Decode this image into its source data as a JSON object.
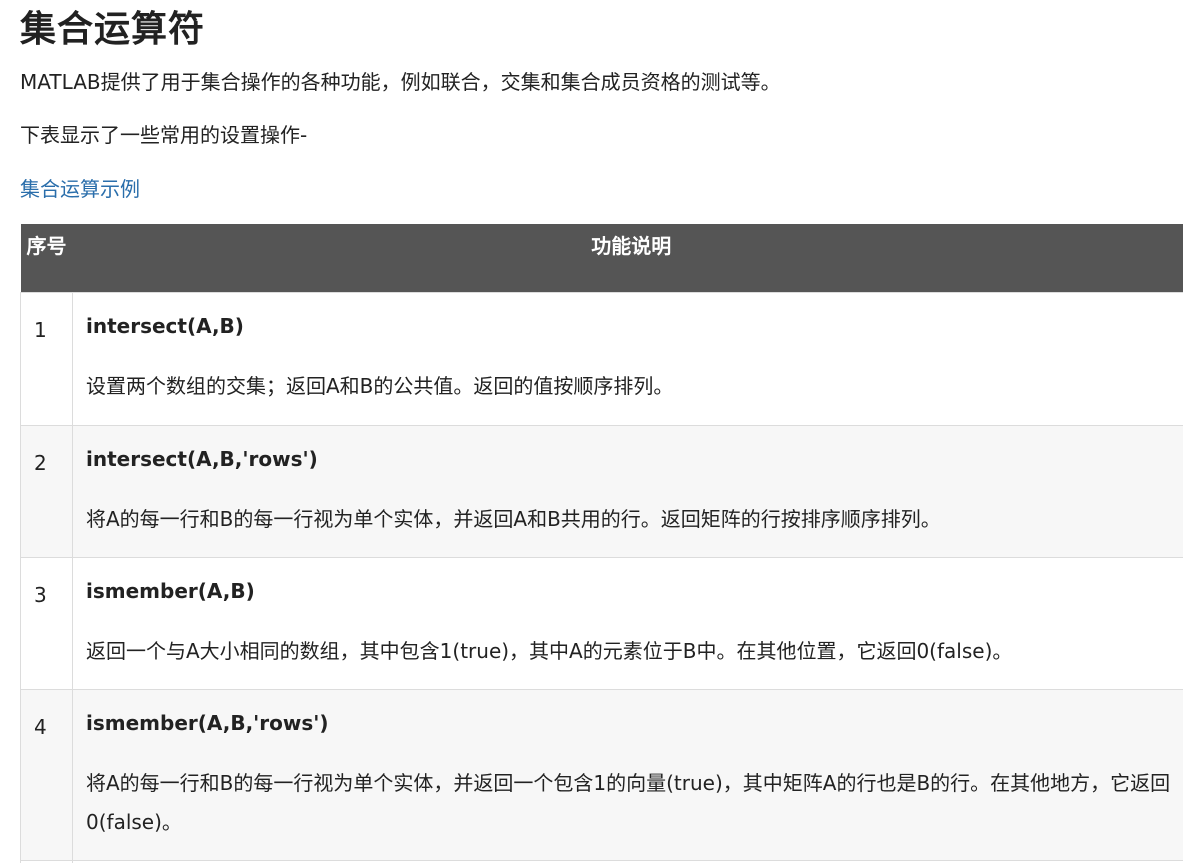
{
  "title": "集合运算符",
  "intro": "MATLAB提供了用于集合操作的各种功能，例如联合，交集和集合成员资格的测试等。",
  "subintro": "下表显示了一些常用的设置操作-",
  "example_link": "集合运算示例",
  "table": {
    "headers": [
      "序号",
      "功能说明"
    ],
    "rows": [
      {
        "num": "1",
        "func": "intersect(A,B)",
        "desc": "设置两个数组的交集；返回A和B的公共值。返回的值按顺序排列。"
      },
      {
        "num": "2",
        "func": "intersect(A,B,'rows')",
        "desc": "将A的每一行和B的每一行视为单个实体，并返回A和B共用的行。返回矩阵的行按排序顺序排列。"
      },
      {
        "num": "3",
        "func": "ismember(A,B)",
        "desc": "返回一个与A大小相同的数组，其中包含1(true)，其中A的元素位于B中。在其他位置，它返回0(false)。"
      },
      {
        "num": "4",
        "func": "ismember(A,B,'rows')",
        "desc": "将A的每一行和B的每一行视为单个实体，并返回一个包含1的向量(true)，其中矩阵A的行也是B的行。在其他地方，它返回0(false)。"
      }
    ]
  },
  "colors": {
    "header_bg": "#555555",
    "link": "#2a6eab",
    "row_alt": "#f7f7f7"
  }
}
